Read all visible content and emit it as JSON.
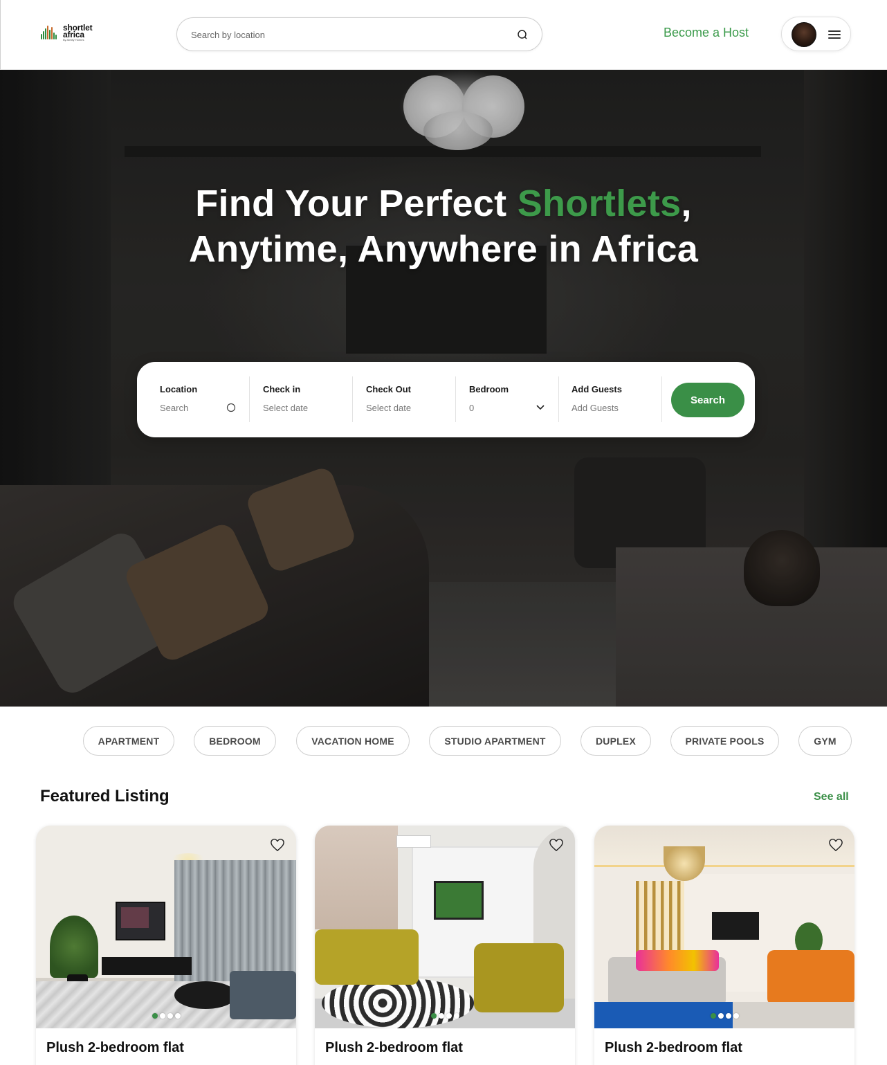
{
  "header": {
    "logo": {
      "line1": "shortlet",
      "line2": "africa",
      "line3": "By Airbify Homes"
    },
    "search_placeholder": "Search by location",
    "become_host": "Become a Host"
  },
  "hero": {
    "title_part1": "Find Your Perfect ",
    "title_accent": "Shortlets",
    "title_part2": ",",
    "title_line2": "Anytime, Anywhere in Africa"
  },
  "booking": {
    "location": {
      "label": "Location",
      "value": "Search"
    },
    "check_in": {
      "label": "Check in",
      "value": "Select date"
    },
    "check_out": {
      "label": "Check Out",
      "value": "Select date"
    },
    "bedroom": {
      "label": "Bedroom",
      "value": "0"
    },
    "guests": {
      "label": "Add Guests",
      "value": "Add Guests"
    },
    "search_label": "Search"
  },
  "categories": [
    "APARTMENT",
    "BEDROOM",
    "VACATION HOME",
    "STUDIO APARTMENT",
    "DUPLEX",
    "PRIVATE POOLS",
    "GYM"
  ],
  "featured": {
    "title": "Featured Listing",
    "see_all": "See all",
    "listings": [
      {
        "title": "Plush 2-bedroom flat",
        "active_dot": 0,
        "dot_count": 4
      },
      {
        "title": "Plush 2-bedroom flat",
        "active_dot": 0,
        "dot_count": 4
      },
      {
        "title": "Plush 2-bedroom flat",
        "active_dot": 0,
        "dot_count": 4
      }
    ]
  },
  "colors": {
    "accent": "#3a8f47",
    "accent_text": "#3d9a4a"
  },
  "icons": [
    "search-icon",
    "chevron-down-icon",
    "menu-icon",
    "heart-icon",
    "avatar"
  ]
}
